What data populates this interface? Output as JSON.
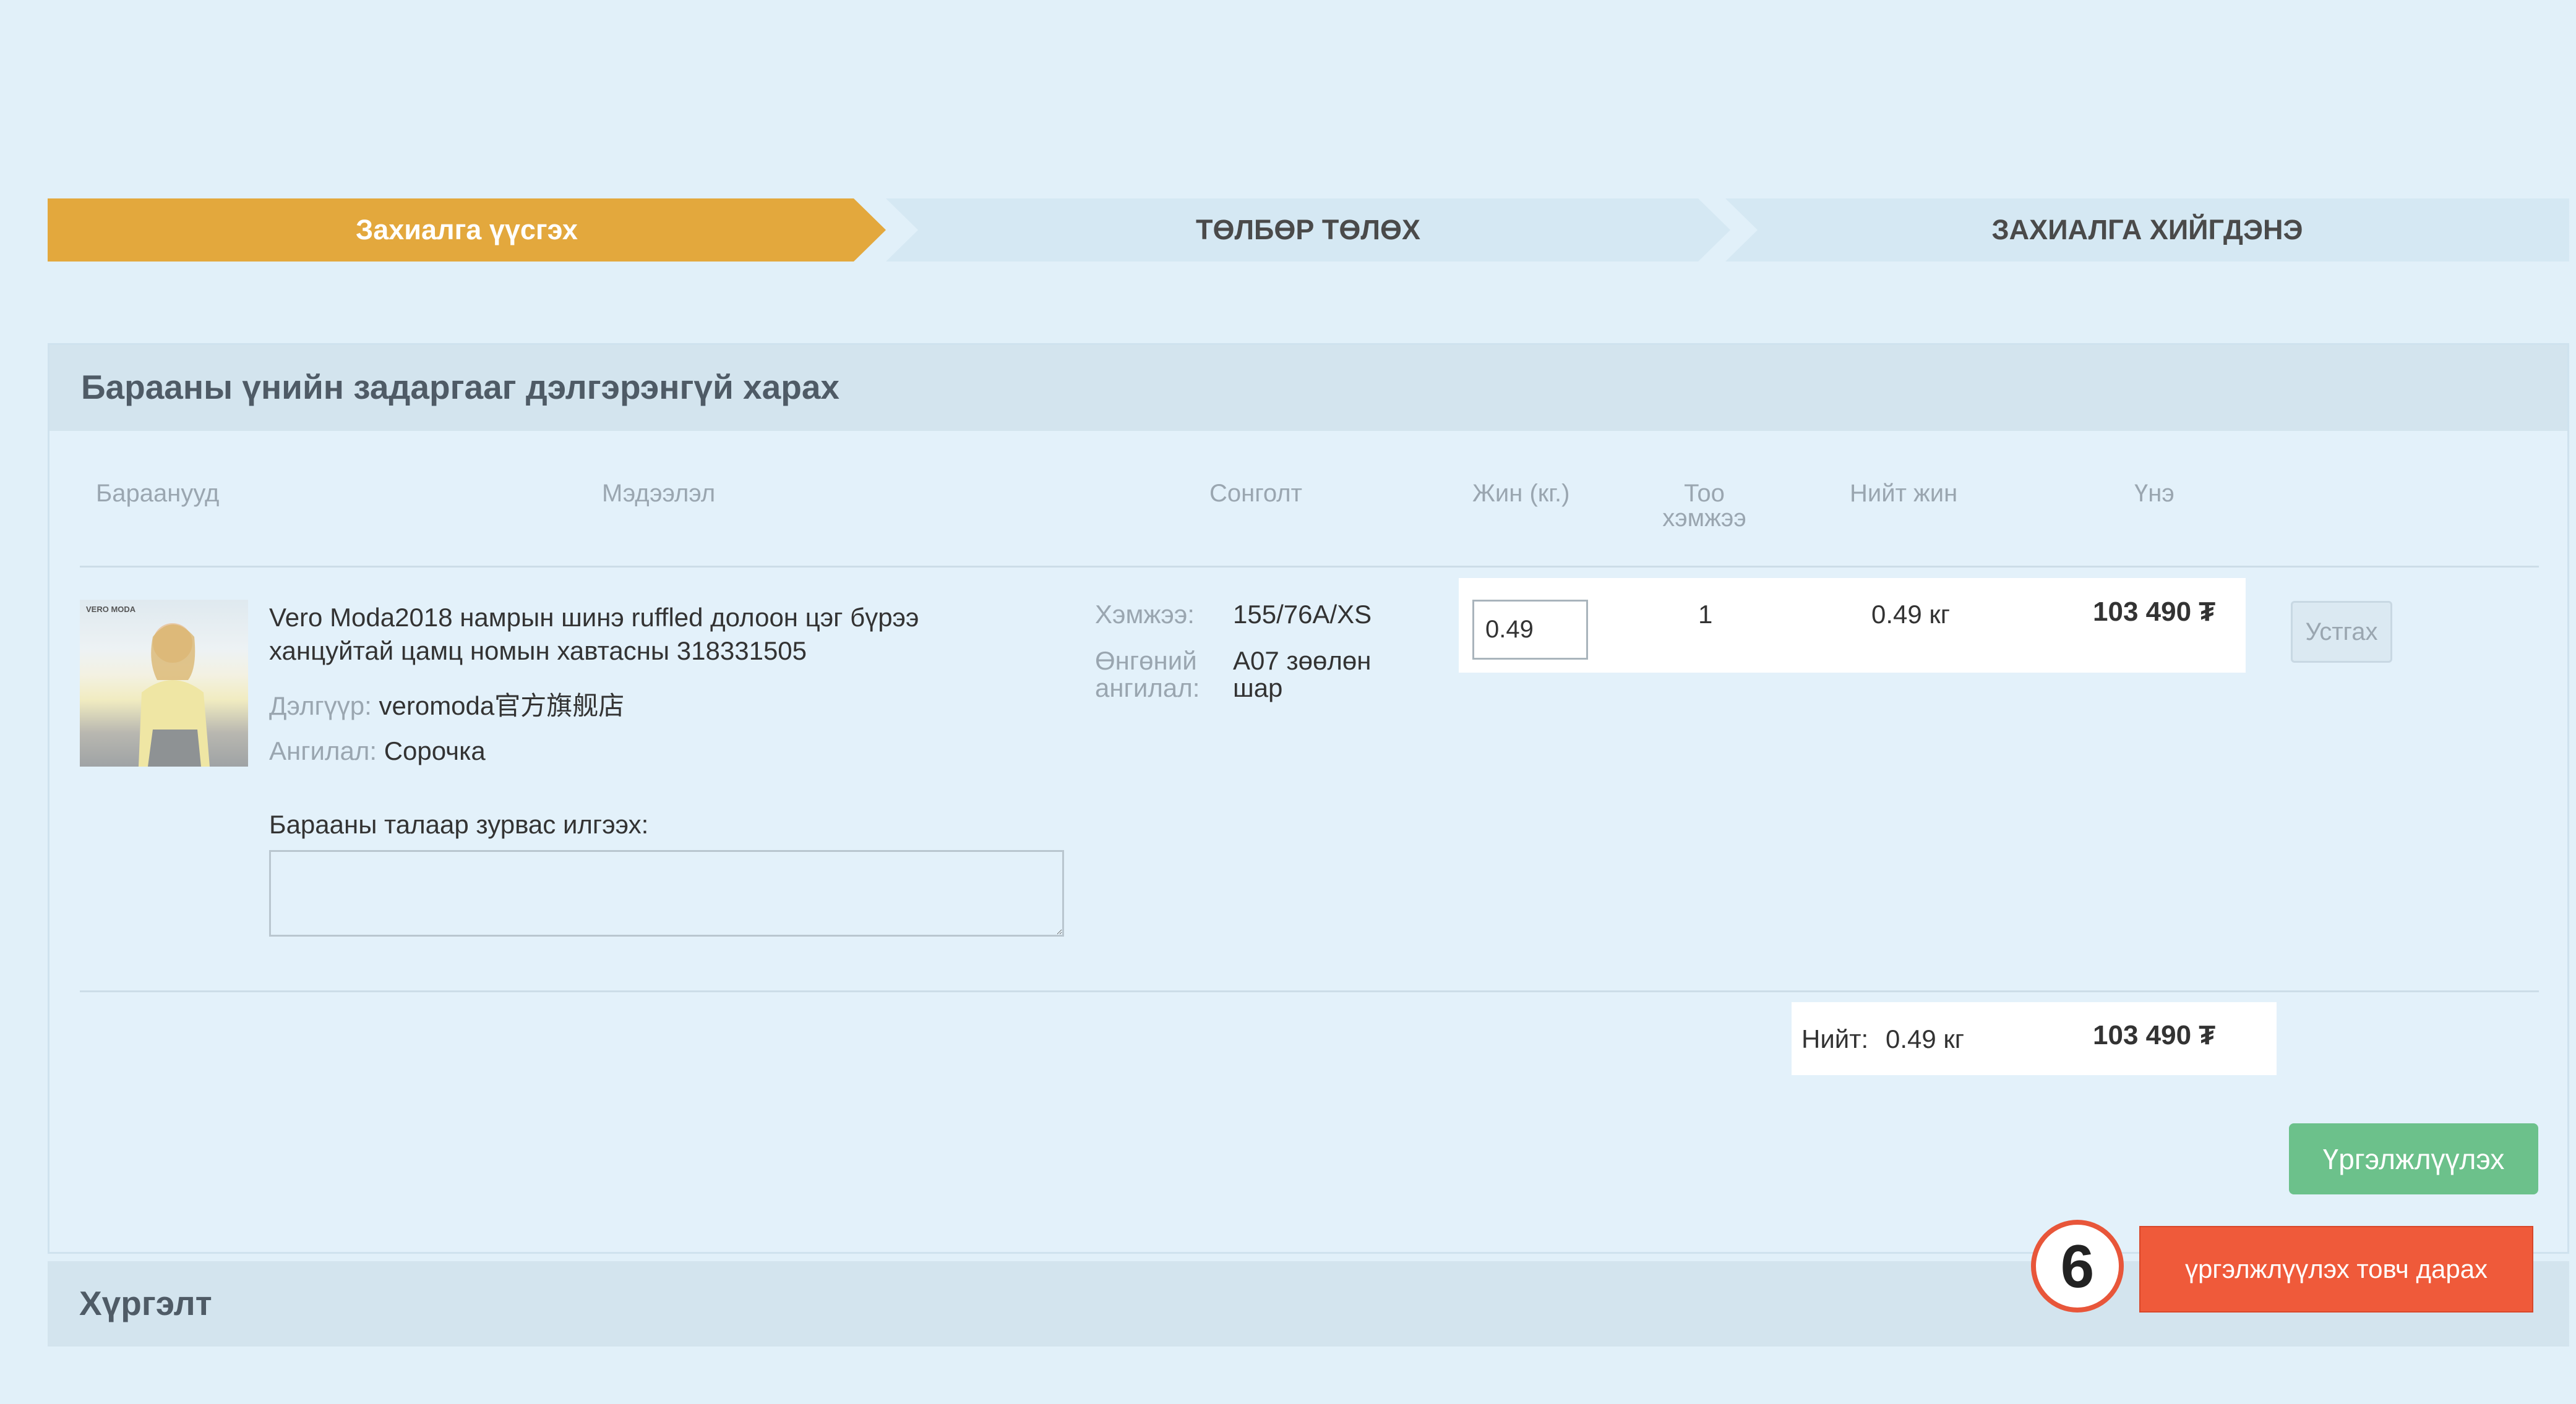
{
  "steps": [
    {
      "label": "Захиалга үүсгэх"
    },
    {
      "label": "ТӨЛБӨР ТӨЛӨХ"
    },
    {
      "label": "ЗАХИАЛГА ХИЙГДЭНЭ"
    }
  ],
  "price_panel": {
    "title": "Барааны үнийн задаргааг дэлгэрэнгүй харах",
    "columns": {
      "products": "Бараанууд",
      "info": "Мэдээлэл",
      "option": "Сонголт",
      "weight": "Жин (кг.)",
      "quantity_line1": "Тоо",
      "quantity_line2": "хэмжээ",
      "total_weight": "Нийт жин",
      "price": "Үнэ"
    },
    "item": {
      "thumb_brand": "VERO MODA",
      "title_line1": "Vero Moda2018 намрын шинэ ruffled долоон цэг бүрээ",
      "title_line2": "ханцуйтай цамц номын хавтасны 318331505",
      "store_label": "Дэлгүүр:",
      "store_value": "veromoda官方旗舰店",
      "category_label": "Ангилал:",
      "category_value": "Сорочка",
      "size_label": "Хэмжээ:",
      "size_value": "155/76A/XS",
      "color_label_line1": "Өнгөний",
      "color_label_line2": "ангилал:",
      "color_value_line1": "A07 зөөлөн",
      "color_value_line2": "шар",
      "weight_value": "0.49",
      "quantity": "1",
      "total_weight": "0.49 кг",
      "price": "103 490 ₮",
      "remove_label": "Устгах",
      "message_label": "Барааны талаар зурвас илгээх:",
      "message_value": ""
    },
    "summary": {
      "total_label": "Нийт:",
      "total_weight": "0.49 кг",
      "total_price": "103 490 ₮"
    },
    "continue_label": "Үргэлжлүүлэх"
  },
  "delivery": {
    "title": "Хүргэлт"
  },
  "callout": {
    "number": "6",
    "text": "үргэлжлүүлэх товч дарах"
  },
  "colors": {
    "active_step": "#e3a83d",
    "continue_button": "#6cc18b",
    "callout": "#ef5a3a"
  }
}
